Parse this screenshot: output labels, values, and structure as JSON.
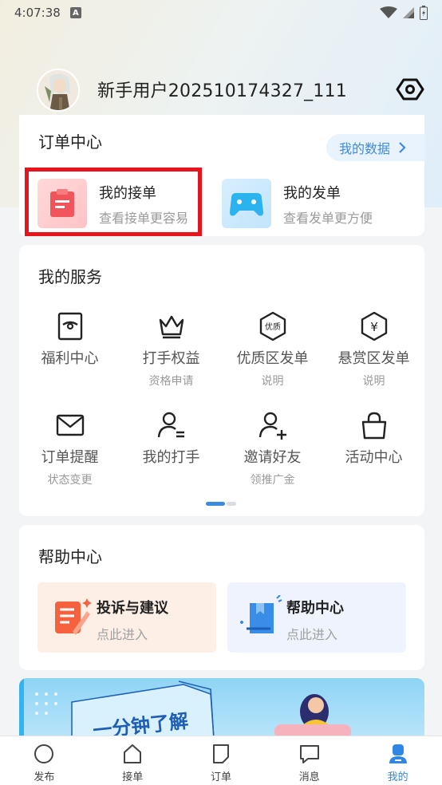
{
  "status_bar": {
    "time": "4:07:38",
    "notification_badge": "A"
  },
  "profile": {
    "username": "新手用户202510174327_111"
  },
  "order_center": {
    "title": "订单中心",
    "my_data_label": "我的数据",
    "items": [
      {
        "title": "我的接单",
        "subtitle": "查看接单更容易",
        "icon": "order-receive-icon"
      },
      {
        "title": "我的发单",
        "subtitle": "查看发单更方便",
        "icon": "gamepad-icon"
      }
    ]
  },
  "services": {
    "title": "我的服务",
    "items": [
      {
        "label": "福利中心",
        "sub": "",
        "icon": "welfare-icon"
      },
      {
        "label": "打手权益",
        "sub": "资格申请",
        "icon": "crown-icon"
      },
      {
        "label": "优质区发单",
        "sub": "说明",
        "icon": "premium-icon",
        "icon_text": "优质"
      },
      {
        "label": "悬赏区发单",
        "sub": "说明",
        "icon": "reward-icon",
        "icon_text": "¥"
      },
      {
        "label": "订单提醒",
        "sub": "状态变更",
        "icon": "mail-icon"
      },
      {
        "label": "我的打手",
        "sub": "",
        "icon": "user-list-icon"
      },
      {
        "label": "邀请好友",
        "sub": "领推广金",
        "icon": "user-add-icon"
      },
      {
        "label": "活动中心",
        "sub": "",
        "icon": "bag-icon"
      }
    ]
  },
  "help_center": {
    "title": "帮助中心",
    "tiles": [
      {
        "title": "投诉与建议",
        "subtitle": "点此进入",
        "icon": "complaint-icon"
      },
      {
        "title": "帮助中心",
        "subtitle": "点此进入",
        "icon": "help-book-icon"
      }
    ]
  },
  "banner": {
    "text": "一分钟了解"
  },
  "bottom_nav": {
    "items": [
      {
        "label": "发布",
        "icon": "publish-icon"
      },
      {
        "label": "接单",
        "icon": "home-icon"
      },
      {
        "label": "订单",
        "icon": "order-icon"
      },
      {
        "label": "消息",
        "icon": "message-icon"
      },
      {
        "label": "我的",
        "icon": "profile-icon"
      }
    ],
    "active_index": 4
  },
  "colors": {
    "accent": "#2f86e5",
    "highlight": "#e8141b"
  }
}
